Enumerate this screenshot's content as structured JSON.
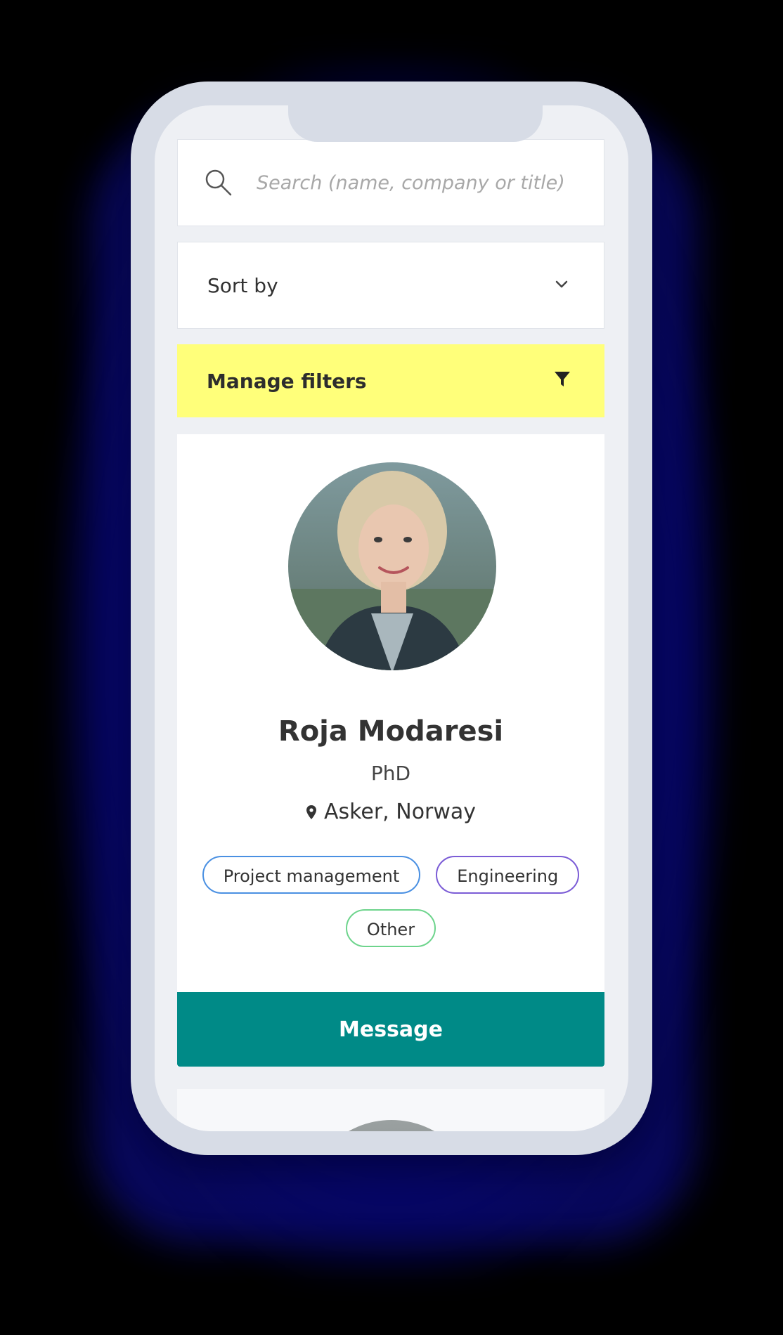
{
  "search": {
    "placeholder": "Search (name, company or title)",
    "icon": "search-icon"
  },
  "sort": {
    "label": "Sort by",
    "icon": "chevron-down-icon"
  },
  "filters": {
    "label": "Manage filters",
    "icon": "filter-icon",
    "color": "#ffff7a"
  },
  "profile": {
    "name": "Roja Modaresi",
    "title": "PhD",
    "location": "Asker, Norway",
    "tags": [
      {
        "label": "Project management",
        "color": "#4a90e2"
      },
      {
        "label": "Engineering",
        "color": "#7b5cd6"
      },
      {
        "label": "Other",
        "color": "#6dd48c"
      }
    ],
    "message_label": "Message",
    "message_color": "#008a87"
  }
}
